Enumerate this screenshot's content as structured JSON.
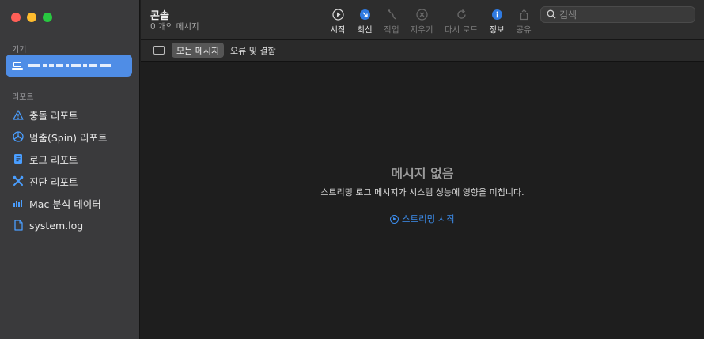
{
  "window": {
    "title": "콘솔",
    "subtitle": "0 개의 메시지"
  },
  "sidebar": {
    "devices_label": "기기",
    "reports_label": "리포트",
    "reports": [
      {
        "label": "충돌 리포트",
        "icon": "warning-icon"
      },
      {
        "label": "멈춤(Spin) 리포트",
        "icon": "spin-icon"
      },
      {
        "label": "로그 리포트",
        "icon": "log-report-icon"
      },
      {
        "label": "진단 리포트",
        "icon": "tools-icon"
      },
      {
        "label": "Mac 분석 데이터",
        "icon": "analytics-icon"
      },
      {
        "label": "system.log",
        "icon": "document-icon"
      }
    ]
  },
  "toolbar": {
    "start": "시작",
    "now": "최신",
    "activities": "작업",
    "clear": "지우기",
    "reload": "다시 로드",
    "info": "정보",
    "share": "공유"
  },
  "search": {
    "placeholder": "검색"
  },
  "filters": {
    "all_messages": "모든 메시지",
    "errors_faults": "오류 및 결함"
  },
  "empty_state": {
    "title": "메시지 없음",
    "description": "스트리밍 로그 메시지가 시스템 성능에 영향을 미칩니다.",
    "action": "스트리밍 시작"
  },
  "colors": {
    "accent": "#3d8ff0",
    "selection": "#4f8de6",
    "sidebar_icon": "#4a9eff"
  }
}
